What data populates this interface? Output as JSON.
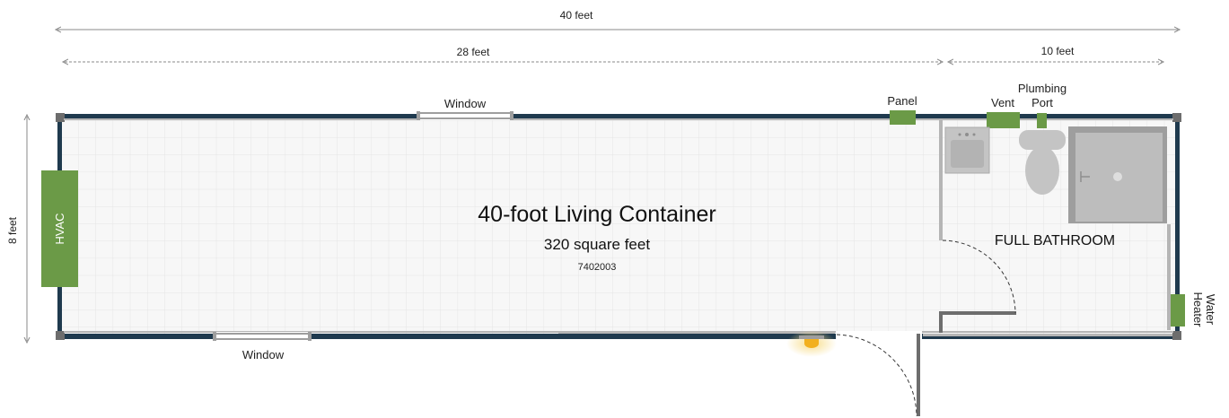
{
  "dimensions": {
    "overall_length": "40 feet",
    "living_length": "28 feet",
    "bath_length": "10 feet",
    "width": "8 feet"
  },
  "container": {
    "title": "40-foot Living Container",
    "area": "320 square feet",
    "code": "7402003"
  },
  "labels": {
    "window_top": "Window",
    "window_bottom": "Window",
    "panel": "Panel",
    "vent": "Vent",
    "plumbing_line1": "Plumbing",
    "plumbing_line2": "Port",
    "hvac": "HVAC",
    "water_line1": "Water",
    "water_line2": "Heater",
    "bathroom": "FULL BATHROOM"
  },
  "colors": {
    "equipment_green": "#6b9a47",
    "container_wall": "#1f3a4e",
    "interior_wall": "#9e9e9e",
    "floor": "#f7f7f7",
    "fixture_gray": "#c4c4c4",
    "light": "#f2b01e"
  }
}
